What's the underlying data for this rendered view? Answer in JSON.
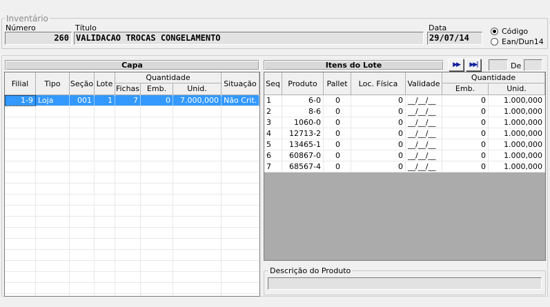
{
  "inventario": {
    "group_title": "Inventário",
    "numero_label": "Número",
    "numero_value": "260",
    "titulo_label": "Título",
    "titulo_value": "VALIDACAO TROCAS CONGELAMENTO",
    "data_label": "Data",
    "data_value": "29/07/14",
    "radio_codigo": "Código",
    "radio_ean": "Ean/Dun14",
    "selected_radio": "Código"
  },
  "capa": {
    "title": "Capa",
    "headers": {
      "filial": "Filial",
      "tipo": "Tipo",
      "secao": "Seção",
      "lote": "Lote",
      "quantidade": "Quantidade",
      "fichas": "Fichas",
      "emb": "Emb.",
      "unid": "Unid.",
      "situacao": "Situação"
    },
    "rows": [
      {
        "filial": "1-9",
        "tipo": "Loja",
        "secao": "001",
        "lote": "1",
        "fichas": "7",
        "emb": "0",
        "unid": "7.000,000",
        "situacao": "Não Crit."
      }
    ]
  },
  "itens": {
    "title": "Itens do Lote",
    "nav_next_icon": "fast-forward-icon",
    "nav_last_icon": "skip-to-end-icon",
    "page_value": "",
    "de_label": "De",
    "total_value": "",
    "headers": {
      "seq": "Seq",
      "produto": "Produto",
      "pallet": "Pallet",
      "loc": "Loc. Física",
      "validade": "Validade",
      "quantidade": "Quantidade",
      "emb": "Emb.",
      "unid": "Unid."
    },
    "rows": [
      {
        "seq": "1",
        "produto": "6-0",
        "pallet": "0",
        "loc": "0",
        "validade": "__/__/__",
        "emb": "0",
        "unid": "1.000,000"
      },
      {
        "seq": "2",
        "produto": "8-6",
        "pallet": "0",
        "loc": "0",
        "validade": "__/__/__",
        "emb": "0",
        "unid": "1.000,000"
      },
      {
        "seq": "3",
        "produto": "1060-0",
        "pallet": "0",
        "loc": "0",
        "validade": "__/__/__",
        "emb": "0",
        "unid": "1.000,000"
      },
      {
        "seq": "4",
        "produto": "12713-2",
        "pallet": "0",
        "loc": "0",
        "validade": "__/__/__",
        "emb": "0",
        "unid": "1.000,000"
      },
      {
        "seq": "5",
        "produto": "13465-1",
        "pallet": "0",
        "loc": "0",
        "validade": "__/__/__",
        "emb": "0",
        "unid": "1.000,000"
      },
      {
        "seq": "6",
        "produto": "60867-0",
        "pallet": "0",
        "loc": "0",
        "validade": "__/__/__",
        "emb": "0",
        "unid": "1.000,000"
      },
      {
        "seq": "7",
        "produto": "68567-4",
        "pallet": "0",
        "loc": "0",
        "validade": "__/__/__",
        "emb": "0",
        "unid": "1.000,000"
      }
    ]
  },
  "descricao": {
    "group_title": "Descrição do Produto",
    "value": ""
  },
  "colors": {
    "selection": "#3399ff",
    "background": "#f0f0f0",
    "grey_area": "#ababab"
  }
}
